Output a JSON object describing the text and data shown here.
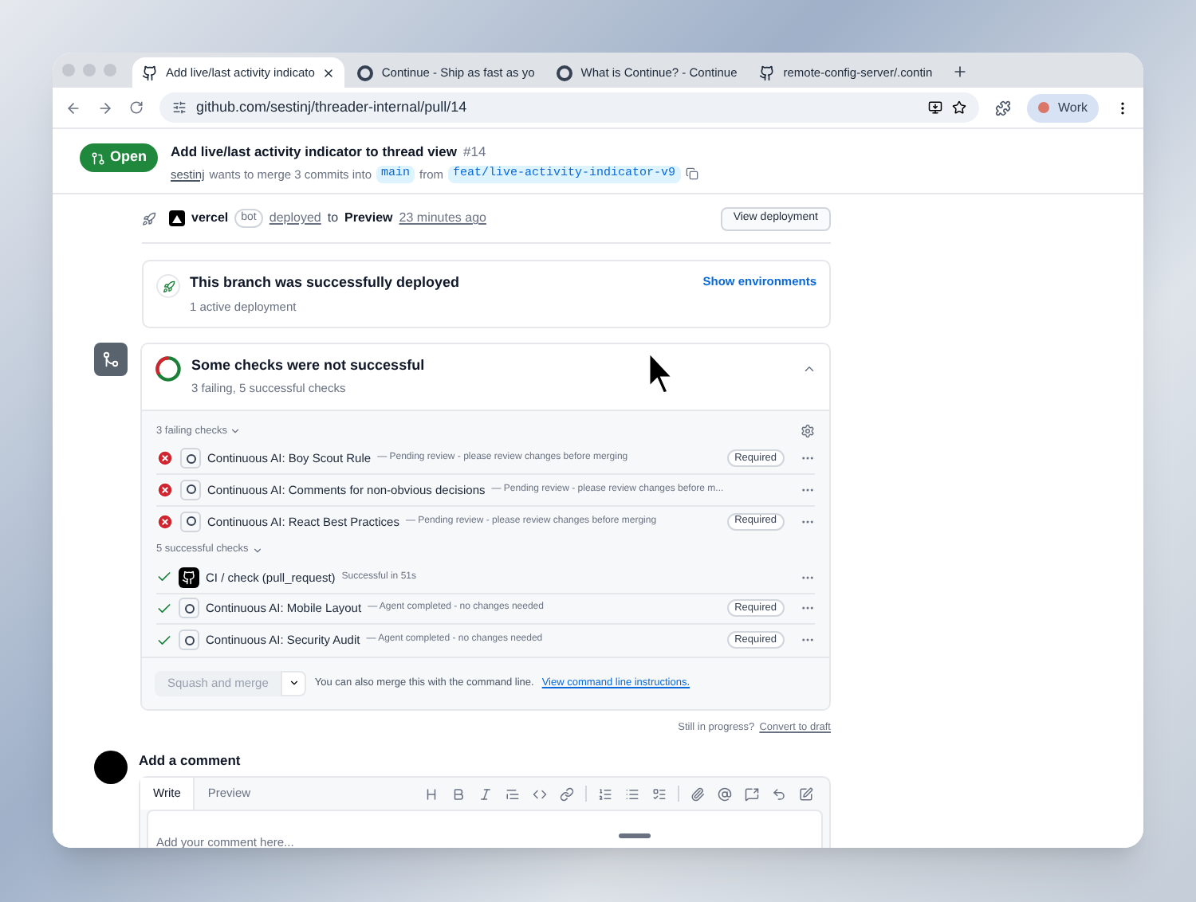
{
  "browser_tabs": [
    {
      "title": "Add live/last activity indicato",
      "selected": true,
      "kind": "github"
    },
    {
      "title": "Continue - Ship as fast as yo",
      "selected": false,
      "kind": "continue"
    },
    {
      "title": "What is Continue? - Continue",
      "selected": false,
      "kind": "continue"
    },
    {
      "title": "remote-config-server/.contin",
      "selected": false,
      "kind": "github"
    }
  ],
  "address": "github.com/sestinj/threader-internal/pull/14",
  "profile": "Work",
  "pr": {
    "state": "Open",
    "title": "Add live/last activity indicator to thread view",
    "number": "#14",
    "author": "sestinj",
    "merge_text": "wants to merge 3 commits into",
    "base": "main",
    "from": "from",
    "head": "feat/live-activity-indicator-v9"
  },
  "deploy_event": {
    "actor": "vercel",
    "badge": "bot",
    "action": "deployed",
    "to": "to",
    "env": "Preview",
    "time": "23 minutes ago",
    "button": "View deployment"
  },
  "deployment_box": {
    "title": "This branch was successfully deployed",
    "subtitle": "1 active deployment",
    "link": "Show environments"
  },
  "checks": {
    "title": "Some checks were not successful",
    "subtitle": "3 failing, 5 successful checks",
    "expanded": true,
    "groups": [
      {
        "label": "3 failing checks",
        "kind": "failing",
        "items": [
          {
            "name": "Continuous AI: Boy Scout Rule",
            "detail": "— Pending review - please review changes before merging",
            "kind": "continue",
            "badge": "Required"
          },
          {
            "name": "Continuous AI: Comments for non-obvious decisions",
            "detail": "— Pending review - please review changes before m...",
            "kind": "continue"
          },
          {
            "name": "Continuous AI: React Best Practices",
            "detail": "— Pending review - please review changes before merging",
            "kind": "continue",
            "badge": "Required"
          }
        ]
      },
      {
        "label": "5 successful checks",
        "kind": "success",
        "items": [
          {
            "name": "CI / check (pull_request)",
            "detail": "Successful in 51s",
            "kind": "github"
          },
          {
            "name": "Continuous AI: Mobile Layout",
            "detail": "— Agent completed - no changes needed",
            "kind": "continue",
            "badge": "Required"
          },
          {
            "name": "Continuous AI: Security Audit",
            "detail": "— Agent completed - no changes needed",
            "kind": "continue",
            "badge": "Required"
          }
        ]
      }
    ],
    "merge_button": "Squash and merge",
    "merge_note": "You can also merge this with the command line.",
    "merge_link": "View command line instructions."
  },
  "draft_note": "Still in progress?",
  "draft_link": "Convert to draft",
  "comment": {
    "heading": "Add a comment",
    "tabs": [
      {
        "label": "Write",
        "selected": true
      },
      {
        "label": "Preview",
        "selected": false
      }
    ],
    "placeholder": "Add your comment here..."
  }
}
